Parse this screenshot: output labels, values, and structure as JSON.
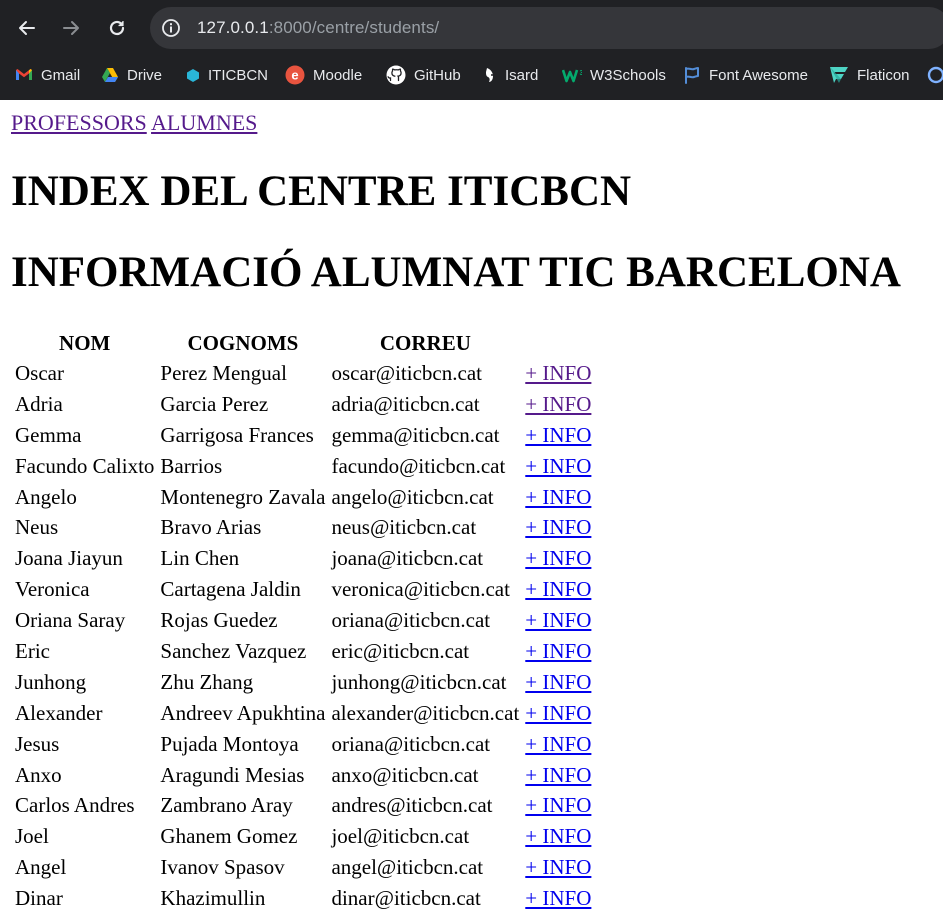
{
  "browser": {
    "url_host": "127.0.0.1",
    "url_path": ":8000/centre/students/",
    "bookmarks": [
      {
        "label": "Gmail",
        "icon": "gmail-icon"
      },
      {
        "label": "Drive",
        "icon": "drive-icon"
      },
      {
        "label": "ITICBCN",
        "icon": "iticbcn-icon"
      },
      {
        "label": "Moodle",
        "icon": "moodle-icon"
      },
      {
        "label": "GitHub",
        "icon": "github-icon"
      },
      {
        "label": "Isard",
        "icon": "isard-icon"
      },
      {
        "label": "W3Schools",
        "icon": "w3schools-icon"
      },
      {
        "label": "Font Awesome",
        "icon": "fontawesome-icon"
      },
      {
        "label": "Flaticon",
        "icon": "flaticon-icon"
      }
    ]
  },
  "nav": {
    "professors": "PROFESSORS",
    "alumnes": "ALUMNES"
  },
  "headings": {
    "index": "INDEX DEL CENTRE ITICBCN",
    "info": "INFORMACIÓ ALUMNAT TIC BARCELONA"
  },
  "table": {
    "headers": [
      "NOM",
      "COGNOMS",
      "CORREU"
    ],
    "link_label": "+ INFO",
    "rows": [
      {
        "nom": "Oscar",
        "cognoms": "Perez Mengual",
        "correu": "oscar@iticbcn.cat",
        "visited": true
      },
      {
        "nom": "Adria",
        "cognoms": "Garcia Perez",
        "correu": "adria@iticbcn.cat",
        "visited": true
      },
      {
        "nom": "Gemma",
        "cognoms": "Garrigosa Frances",
        "correu": "gemma@iticbcn.cat",
        "visited": false
      },
      {
        "nom": "Facundo Calixto",
        "cognoms": "Barrios",
        "correu": "facundo@iticbcn.cat",
        "visited": false
      },
      {
        "nom": "Angelo",
        "cognoms": "Montenegro Zavala",
        "correu": "angelo@iticbcn.cat",
        "visited": false
      },
      {
        "nom": "Neus",
        "cognoms": "Bravo Arias",
        "correu": "neus@iticbcn.cat",
        "visited": false
      },
      {
        "nom": "Joana Jiayun",
        "cognoms": "Lin Chen",
        "correu": "joana@iticbcn.cat",
        "visited": false
      },
      {
        "nom": "Veronica",
        "cognoms": "Cartagena Jaldin",
        "correu": "veronica@iticbcn.cat",
        "visited": false
      },
      {
        "nom": "Oriana Saray",
        "cognoms": "Rojas Guedez",
        "correu": "oriana@iticbcn.cat",
        "visited": false
      },
      {
        "nom": "Eric",
        "cognoms": "Sanchez Vazquez",
        "correu": "eric@iticbcn.cat",
        "visited": false
      },
      {
        "nom": "Junhong",
        "cognoms": "Zhu Zhang",
        "correu": "junhong@iticbcn.cat",
        "visited": false
      },
      {
        "nom": "Alexander",
        "cognoms": "Andreev Apukhtina",
        "correu": "alexander@iticbcn.cat",
        "visited": false
      },
      {
        "nom": "Jesus",
        "cognoms": "Pujada Montoya",
        "correu": "oriana@iticbcn.cat",
        "visited": false
      },
      {
        "nom": "Anxo",
        "cognoms": "Aragundi Mesias",
        "correu": "anxo@iticbcn.cat",
        "visited": false
      },
      {
        "nom": "Carlos Andres",
        "cognoms": "Zambrano Aray",
        "correu": "andres@iticbcn.cat",
        "visited": false
      },
      {
        "nom": "Joel",
        "cognoms": "Ghanem Gomez",
        "correu": "joel@iticbcn.cat",
        "visited": false
      },
      {
        "nom": "Angel",
        "cognoms": "Ivanov Spasov",
        "correu": "angel@iticbcn.cat",
        "visited": false
      },
      {
        "nom": "Dinar",
        "cognoms": "Khazimullin",
        "correu": "dinar@iticbcn.cat",
        "visited": false
      }
    ]
  },
  "colors": {
    "chrome_bg": "#202124",
    "urlbar_bg": "#35363a",
    "link": "#0000ee",
    "link_visited": "#551a8b"
  }
}
